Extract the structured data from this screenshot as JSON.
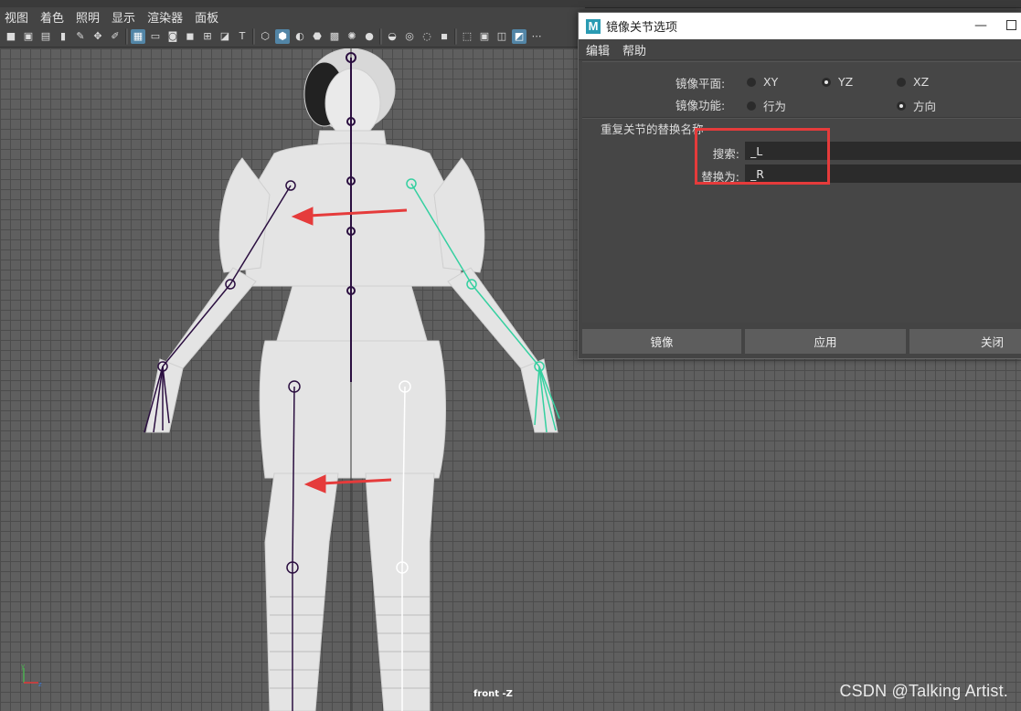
{
  "menubar": {
    "items": [
      "视图",
      "着色",
      "照明",
      "显示",
      "渲染器",
      "面板"
    ]
  },
  "viewport": {
    "camera_label": "front -Z",
    "axis_y": "y",
    "axis_z": "z"
  },
  "watermark": "CSDN @Talking Artist.",
  "dialog": {
    "logo": "M",
    "title": "镜像关节选项",
    "menu": [
      "编辑",
      "帮助"
    ],
    "mirror_plane": {
      "label": "镜像平面:",
      "options": [
        "XY",
        "YZ",
        "XZ"
      ],
      "selected": "YZ"
    },
    "mirror_function": {
      "label": "镜像功能:",
      "options": [
        "行为",
        "方向"
      ],
      "selected": "方向"
    },
    "replace_section_title": "重复关节的替换名称",
    "search": {
      "label": "搜索:",
      "value": "_L"
    },
    "replace": {
      "label": "替换为:",
      "value": "_R"
    },
    "buttons": {
      "mirror": "镜像",
      "apply": "应用",
      "close": "关闭"
    }
  }
}
